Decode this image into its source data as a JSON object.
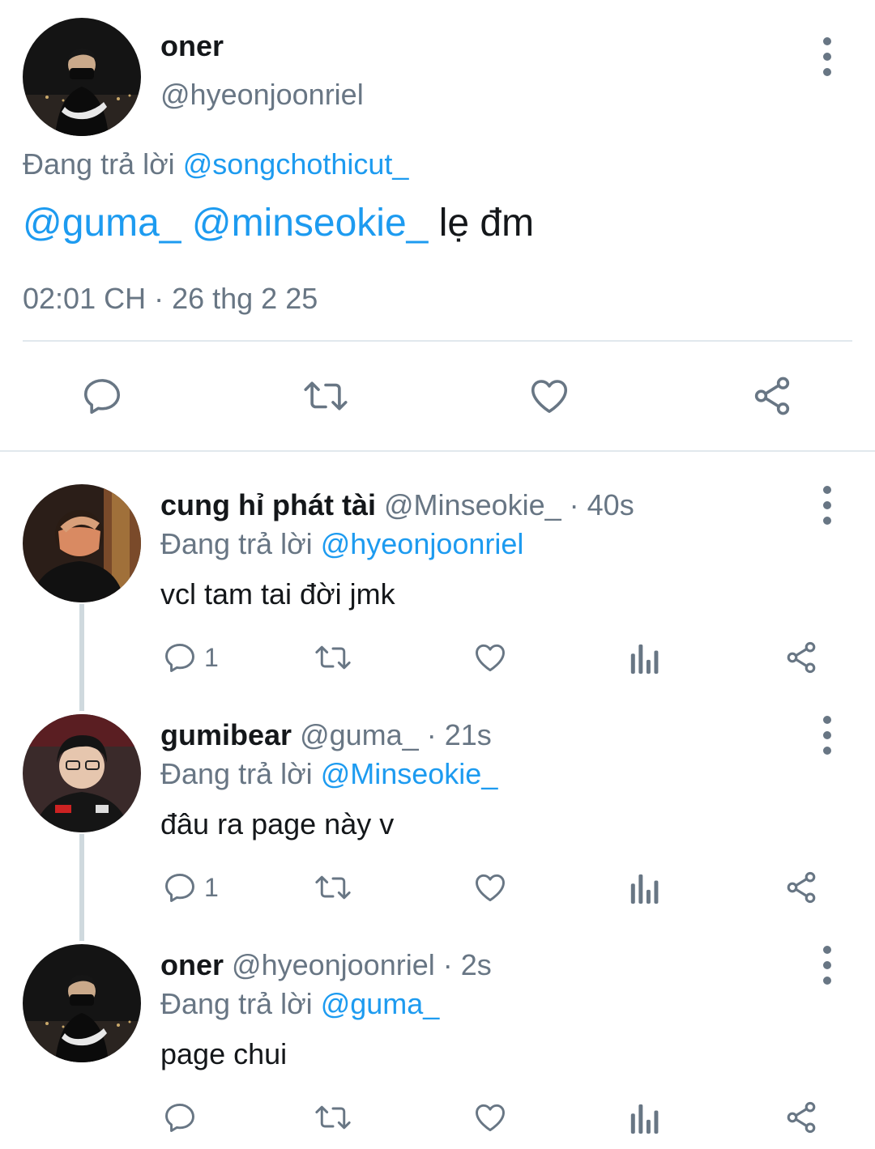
{
  "main_tweet": {
    "display_name": "oner",
    "handle": "@hyeonjoonriel",
    "reply_prefix": "Đang trả lời",
    "reply_to": "@songchothicut_",
    "mention_1": "@guma_",
    "mention_2": "@minseokie_",
    "body": "lẹ đm",
    "timestamp": "02:01 CH · 26 thg 2 25"
  },
  "replies": [
    {
      "display_name": "cung hỉ phát tài",
      "handle": "@Minseokie_",
      "time": "· 40s",
      "reply_prefix": "Đang trả lời",
      "reply_to": "@hyeonjoonriel",
      "text": "vcl tam tai đời jmk",
      "reply_count": "1"
    },
    {
      "display_name": "gumibear",
      "handle": "@guma_",
      "time": "· 21s",
      "reply_prefix": "Đang trả lời",
      "reply_to": "@Minseokie_",
      "text": "đâu ra page này v",
      "reply_count": "1"
    },
    {
      "display_name": "oner",
      "handle": "@hyeonjoonriel",
      "time": "· 2s",
      "reply_prefix": "Đang trả lời",
      "reply_to": "@guma_",
      "text": "page chui",
      "reply_count": ""
    }
  ],
  "colors": {
    "link": "#1d9bf0",
    "secondary_text": "#687684",
    "icon": "#687684",
    "divider": "#e1e8ed",
    "thread_line": "#cfd9de"
  },
  "icons": [
    "reply-icon",
    "retweet-icon",
    "like-icon",
    "share-icon",
    "analytics-icon",
    "more-icon"
  ]
}
